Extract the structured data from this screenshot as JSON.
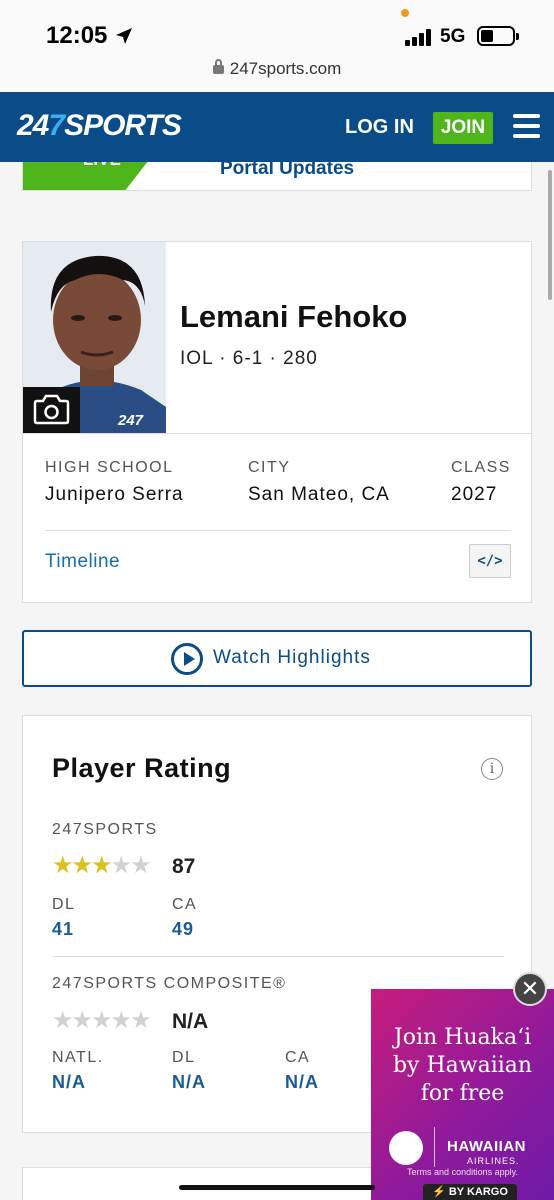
{
  "status_bar": {
    "time": "12:05",
    "network": "5G",
    "url": "247sports.com"
  },
  "header": {
    "logo_prefix": "24",
    "logo_seven": "7",
    "logo_suffix": "SPORTS",
    "login_label": "LOG IN",
    "join_label": "JOIN",
    "accent_color": "#0a4c87",
    "join_color": "#4eb61a"
  },
  "portal_banner": {
    "live_label": "LIVE",
    "text": "Portal Updates"
  },
  "player": {
    "name": "Lemani Fehoko",
    "meta": "IOL · 6-1 · 280",
    "photo_badge": "247",
    "info": [
      {
        "label": "HIGH SCHOOL",
        "value": "Junipero Serra"
      },
      {
        "label": "CITY",
        "value": "San Mateo, CA"
      },
      {
        "label": "CLASS",
        "value": "2027"
      }
    ],
    "timeline_label": "Timeline",
    "embed_label": "</>"
  },
  "watch_highlights": {
    "label": "Watch Highlights"
  },
  "rating": {
    "title": "Player Rating",
    "info_icon": "i",
    "sports247": {
      "label": "247SPORTS",
      "stars_filled": 3,
      "stars_total": 5,
      "score": "87",
      "sub": [
        {
          "label": "DL",
          "value": "41"
        },
        {
          "label": "CA",
          "value": "49"
        }
      ]
    },
    "composite": {
      "label": "247SPORTS COMPOSITE®",
      "stars_filled": 0,
      "stars_total": 5,
      "score": "N/A",
      "sub": [
        {
          "label": "NATL.",
          "value": "N/A"
        },
        {
          "label": "DL",
          "value": "N/A"
        },
        {
          "label": "CA",
          "value": "N/A"
        }
      ]
    }
  },
  "ad": {
    "title_line1": "Join Huakaʻi",
    "title_line2": "by Hawaiian",
    "title_line3": "for free",
    "brand": "HAWAIIAN",
    "brand_sub": "AIRLINES.",
    "terms": "Terms and conditions apply.",
    "kargo": "⚡ BY KARGO",
    "close_label": "✕"
  }
}
